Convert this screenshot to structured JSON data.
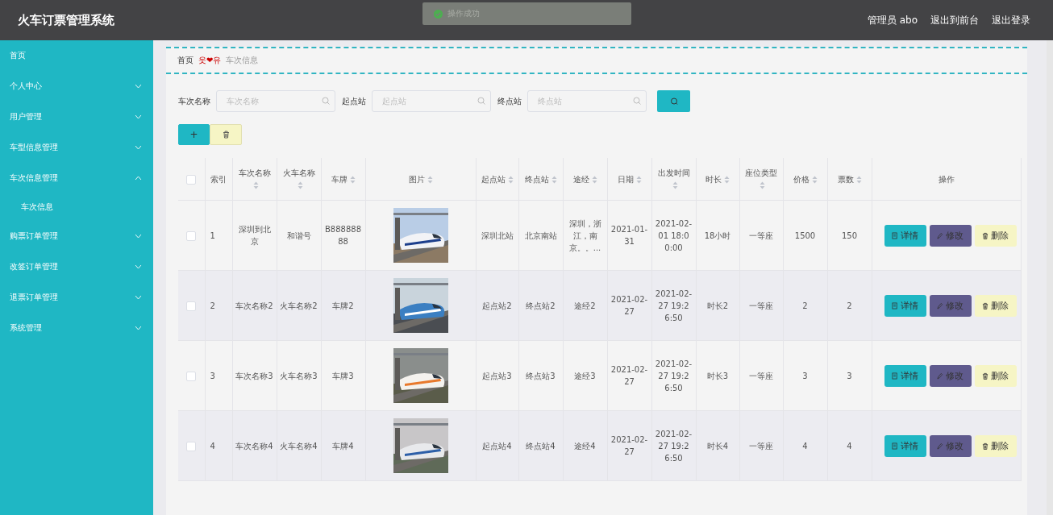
{
  "header": {
    "title": "火车订票管理系统",
    "links": [
      "管理员 abo",
      "退出到前台",
      "退出登录"
    ]
  },
  "toast": {
    "kind": "success",
    "message": "操作成功"
  },
  "sidebar": {
    "items": [
      {
        "label": "首页",
        "kind": "link"
      },
      {
        "label": "个人中心",
        "kind": "menu",
        "expanded": false
      },
      {
        "label": "用户管理",
        "kind": "menu",
        "expanded": false
      },
      {
        "label": "车型信息管理",
        "kind": "menu",
        "expanded": false
      },
      {
        "label": "车次信息管理",
        "kind": "menu",
        "expanded": true,
        "children": [
          {
            "label": "车次信息"
          }
        ]
      },
      {
        "label": "购票订单管理",
        "kind": "menu",
        "expanded": false
      },
      {
        "label": "改签订单管理",
        "kind": "menu",
        "expanded": false
      },
      {
        "label": "退票订单管理",
        "kind": "menu",
        "expanded": false
      },
      {
        "label": "系统管理",
        "kind": "menu",
        "expanded": false
      }
    ]
  },
  "breadcrumb": {
    "home": "首页",
    "separator": "웃❤유",
    "current": "车次信息"
  },
  "search": {
    "fields": [
      {
        "label": "车次名称",
        "placeholder": "车次名称"
      },
      {
        "label": "起点站",
        "placeholder": "起点站"
      },
      {
        "label": "终点站",
        "placeholder": "终点站"
      }
    ]
  },
  "toolbar": {
    "buttons": [
      {
        "kind": "add",
        "label": "+"
      },
      {
        "kind": "delete"
      }
    ]
  },
  "table": {
    "select_all_checked": false,
    "columns": [
      {
        "label": "索引",
        "sortable": false
      },
      {
        "label": "车次名称",
        "sortable": true
      },
      {
        "label": "火车名称",
        "sortable": true
      },
      {
        "label": "车牌",
        "sortable": true
      },
      {
        "label": "图片",
        "sortable": true
      },
      {
        "label": "起点站",
        "sortable": true
      },
      {
        "label": "终点站",
        "sortable": true
      },
      {
        "label": "途经",
        "sortable": true
      },
      {
        "label": "日期",
        "sortable": true
      },
      {
        "label": "出发时间",
        "sortable": true
      },
      {
        "label": "时长",
        "sortable": true
      },
      {
        "label": "座位类型",
        "sortable": true
      },
      {
        "label": "价格",
        "sortable": true
      },
      {
        "label": "票数",
        "sortable": true
      },
      {
        "label": "操作",
        "sortable": false
      }
    ],
    "rows": [
      {
        "checked": false,
        "cells": [
          "1",
          "深圳到北京",
          "和谐号",
          "B88888888",
          {
            "kind": "picture"
          },
          "深圳北站",
          "北京南站",
          "深圳，浙江，南京。。...",
          "2021-01-31",
          "2021-02-01 18:00:00",
          "18小时",
          "一等座",
          "1500",
          "150"
        ],
        "actions": [
          {
            "kind": "detail",
            "label": "详情"
          },
          {
            "kind": "edit",
            "label": "修改"
          },
          {
            "kind": "delete",
            "label": "删除"
          }
        ]
      },
      {
        "checked": false,
        "cells": [
          "2",
          "车次名称2",
          "火车名称2",
          "车牌2",
          {
            "kind": "picture"
          },
          "起点站2",
          "终点站2",
          "途经2",
          "2021-02-27",
          "2021-02-27 19:26:50",
          "时长2",
          "一等座",
          "2",
          "2"
        ],
        "actions": [
          {
            "kind": "detail",
            "label": "详情"
          },
          {
            "kind": "edit",
            "label": "修改"
          },
          {
            "kind": "delete",
            "label": "删除"
          }
        ]
      },
      {
        "checked": false,
        "cells": [
          "3",
          "车次名称3",
          "火车名称3",
          "车牌3",
          {
            "kind": "picture"
          },
          "起点站3",
          "终点站3",
          "途经3",
          "2021-02-27",
          "2021-02-27 19:26:50",
          "时长3",
          "一等座",
          "3",
          "3"
        ],
        "actions": [
          {
            "kind": "detail",
            "label": "详情"
          },
          {
            "kind": "edit",
            "label": "修改"
          },
          {
            "kind": "delete",
            "label": "删除"
          }
        ]
      },
      {
        "checked": false,
        "cells": [
          "4",
          "车次名称4",
          "火车名称4",
          "车牌4",
          {
            "kind": "picture"
          },
          "起点站4",
          "终点站4",
          "途经4",
          "2021-02-27",
          "2021-02-27 19:26:50",
          "时长4",
          "一等座",
          "4",
          "4"
        ],
        "actions": [
          {
            "kind": "detail",
            "label": "详情"
          },
          {
            "kind": "edit",
            "label": "修改"
          },
          {
            "kind": "delete",
            "label": "删除"
          }
        ]
      }
    ]
  }
}
